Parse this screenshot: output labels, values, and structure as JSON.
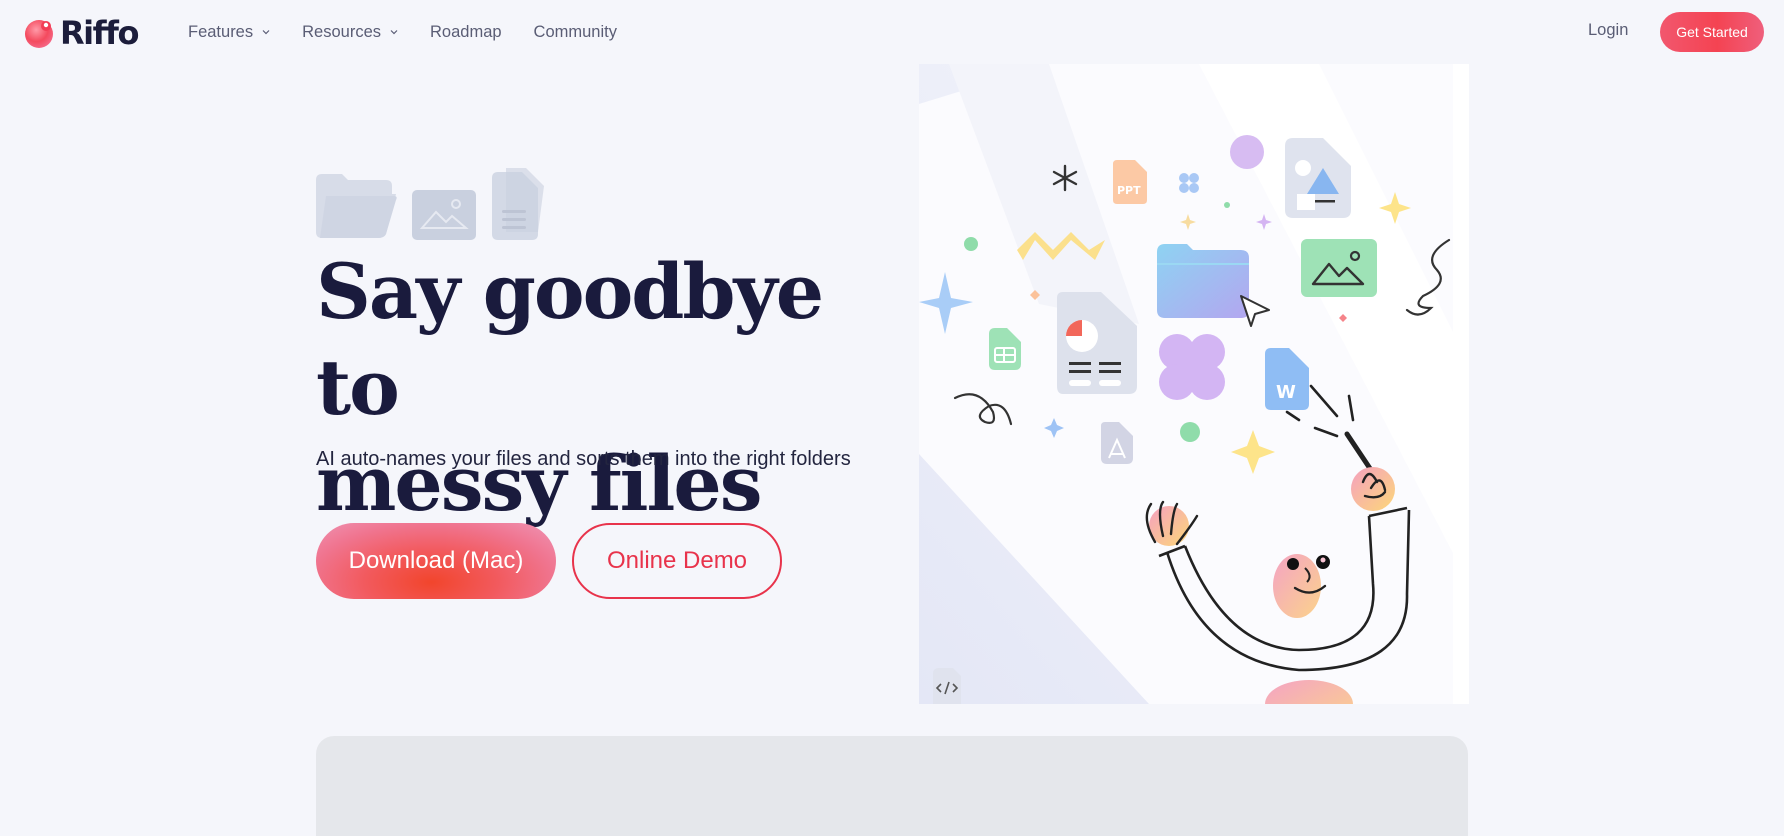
{
  "brand": {
    "name": "Riffo"
  },
  "nav": {
    "items": [
      {
        "label": "Features",
        "dropdown": true
      },
      {
        "label": "Resources",
        "dropdown": true
      },
      {
        "label": "Roadmap",
        "dropdown": false
      },
      {
        "label": "Community",
        "dropdown": false
      }
    ],
    "login_label": "Login",
    "cta_label": "Get Started"
  },
  "hero": {
    "headline_line1": "Say goodbye to",
    "headline_line2": "messy files",
    "subheadline": "AI auto-names your files and sorts them into the right folders",
    "primary_cta": "Download (Mac)",
    "secondary_cta": "Online Demo",
    "decor_icons": [
      "folder-icon",
      "image-file-icon",
      "document-file-icon"
    ],
    "illustration_labels": {
      "ppt": "PPT",
      "word": "W"
    }
  },
  "colors": {
    "accent": "#e8334b",
    "accent_gradient": [
      "#f2576e",
      "#f44352",
      "#ef5f7c"
    ],
    "headline": "#1a1b3d",
    "background": "#f5f6fb",
    "panel": "#e5e7eb"
  }
}
